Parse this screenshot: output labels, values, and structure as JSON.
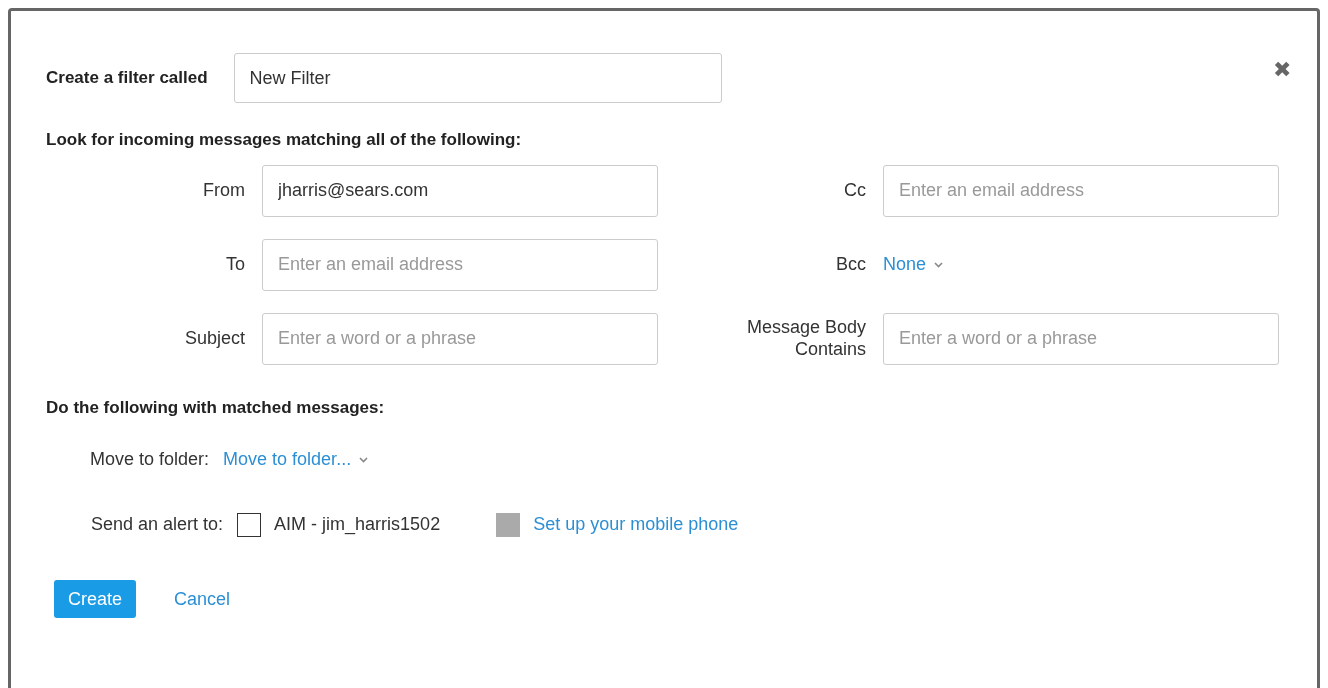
{
  "dialog": {
    "name_label": "Create a filter called",
    "name_value": "New Filter",
    "criteria_heading": "Look for incoming messages matching all of the following:",
    "criteria": [
      {
        "kind": "input",
        "label": "From",
        "value": "jharris@sears.com"
      },
      {
        "kind": "input",
        "label": "Cc",
        "placeholder": "Enter an email address"
      },
      {
        "kind": "input",
        "label": "To",
        "placeholder": "Enter an email address"
      },
      {
        "kind": "dropdown",
        "label": "Bcc",
        "value": "None"
      },
      {
        "kind": "input",
        "label": "Subject",
        "placeholder": "Enter a word or a phrase"
      },
      {
        "kind": "input",
        "label": "Message Body Contains",
        "placeholder": "Enter a word or a phrase"
      }
    ],
    "actions_heading": "Do the following with matched messages:",
    "folder_label": "Move to folder:",
    "folder_value": "Move to folder...",
    "alert_label": "Send an alert to:",
    "alerts": [
      {
        "label": "AIM - jim_harris1502",
        "checked": false,
        "disabled": false
      },
      {
        "label": "Set up your mobile phone",
        "checked": false,
        "disabled": true
      }
    ],
    "buttons": [
      {
        "kind": "primary",
        "label": "Create"
      },
      {
        "kind": "link",
        "label": "Cancel"
      }
    ],
    "close": "✖"
  }
}
